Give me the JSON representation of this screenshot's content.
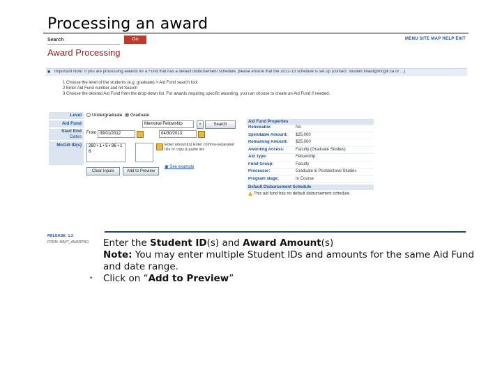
{
  "slide": {
    "title": "Processing an award"
  },
  "screen": {
    "search_label": "Search",
    "go_label": "Go",
    "topnav": "MENU  SITE MAP  HELP  EXIT",
    "page_heading": "Award Processing",
    "important_note": "Important Note: If you are processing awards for a Fund that has a default disbursement schedule, please ensure that the 2012-13 schedule is set up (contact: student.finaid@mcgill.ca or ...)",
    "steps": [
      "1   Choose the level of the students (e.g. graduate) > Aid Fund search tool",
      "2   Enter Aid Fund number and hit Search",
      "3   Choose the desired Aid Fund from the drop-down list. For awards requiring specific awarding, you can choose to create an Aid Fund if needed."
    ],
    "form": {
      "level_label": "Level",
      "level_options": [
        "Undergraduate",
        "Graduate"
      ],
      "aid_fund_label": "Aid Fund",
      "aid_fund_value": "Memorial Fellowship",
      "search_button": "Search",
      "start_end_label": "Start End",
      "dates_label": "Dates",
      "from_label": "From",
      "start_date": "09/01/2012",
      "end_date": "04/30/2013",
      "student_id_label": "McGill ID(s)",
      "amount_hint": "Enter amount(s)",
      "student_hint": "Enter comma-separated IDs or copy & paste list",
      "clear_button": "Clear Inputs",
      "add_preview_button": "Add to Preview",
      "see_example": "See example"
    },
    "fund_properties": {
      "header": "Aid Fund Properties",
      "rows": [
        {
          "k": "Renewable:",
          "v": "No"
        },
        {
          "k": "Spendable Amount:",
          "v": "$25,000"
        },
        {
          "k": "Remaining Amount:",
          "v": "$25,000"
        },
        {
          "k": "Awarding Access:",
          "v": "Faculty (Graduate Studies)"
        },
        {
          "k": "Aid Type:",
          "v": "Fellowship"
        },
        {
          "k": "Fund Group:",
          "v": "Faculty"
        },
        {
          "k": "Processor:",
          "v": "Graduate & Postdoctoral Studies"
        },
        {
          "k": "Program stage:",
          "v": "In Course"
        }
      ],
      "schedule_header": "Default Disbursement Schedule",
      "schedule_warning": "This aid fund has no default disbursement schedule."
    },
    "release": "RELEASE: 1.2",
    "footer_code": "FORM: MAVT_AWARPRO"
  },
  "instructions": {
    "line1_prefix": "Enter the ",
    "line1_b1": "Student ID",
    "line1_mid": "(s) and ",
    "line1_b2": "Award Amount",
    "line1_suffix": "(s)",
    "note_label": "Note:",
    "note_text": "  You may enter multiple Student IDs and amounts for the same Aid Fund and date range.",
    "bullet": "•",
    "line3_prefix": "Click on “",
    "line3_b": "Add to Preview",
    "line3_suffix": "”"
  }
}
